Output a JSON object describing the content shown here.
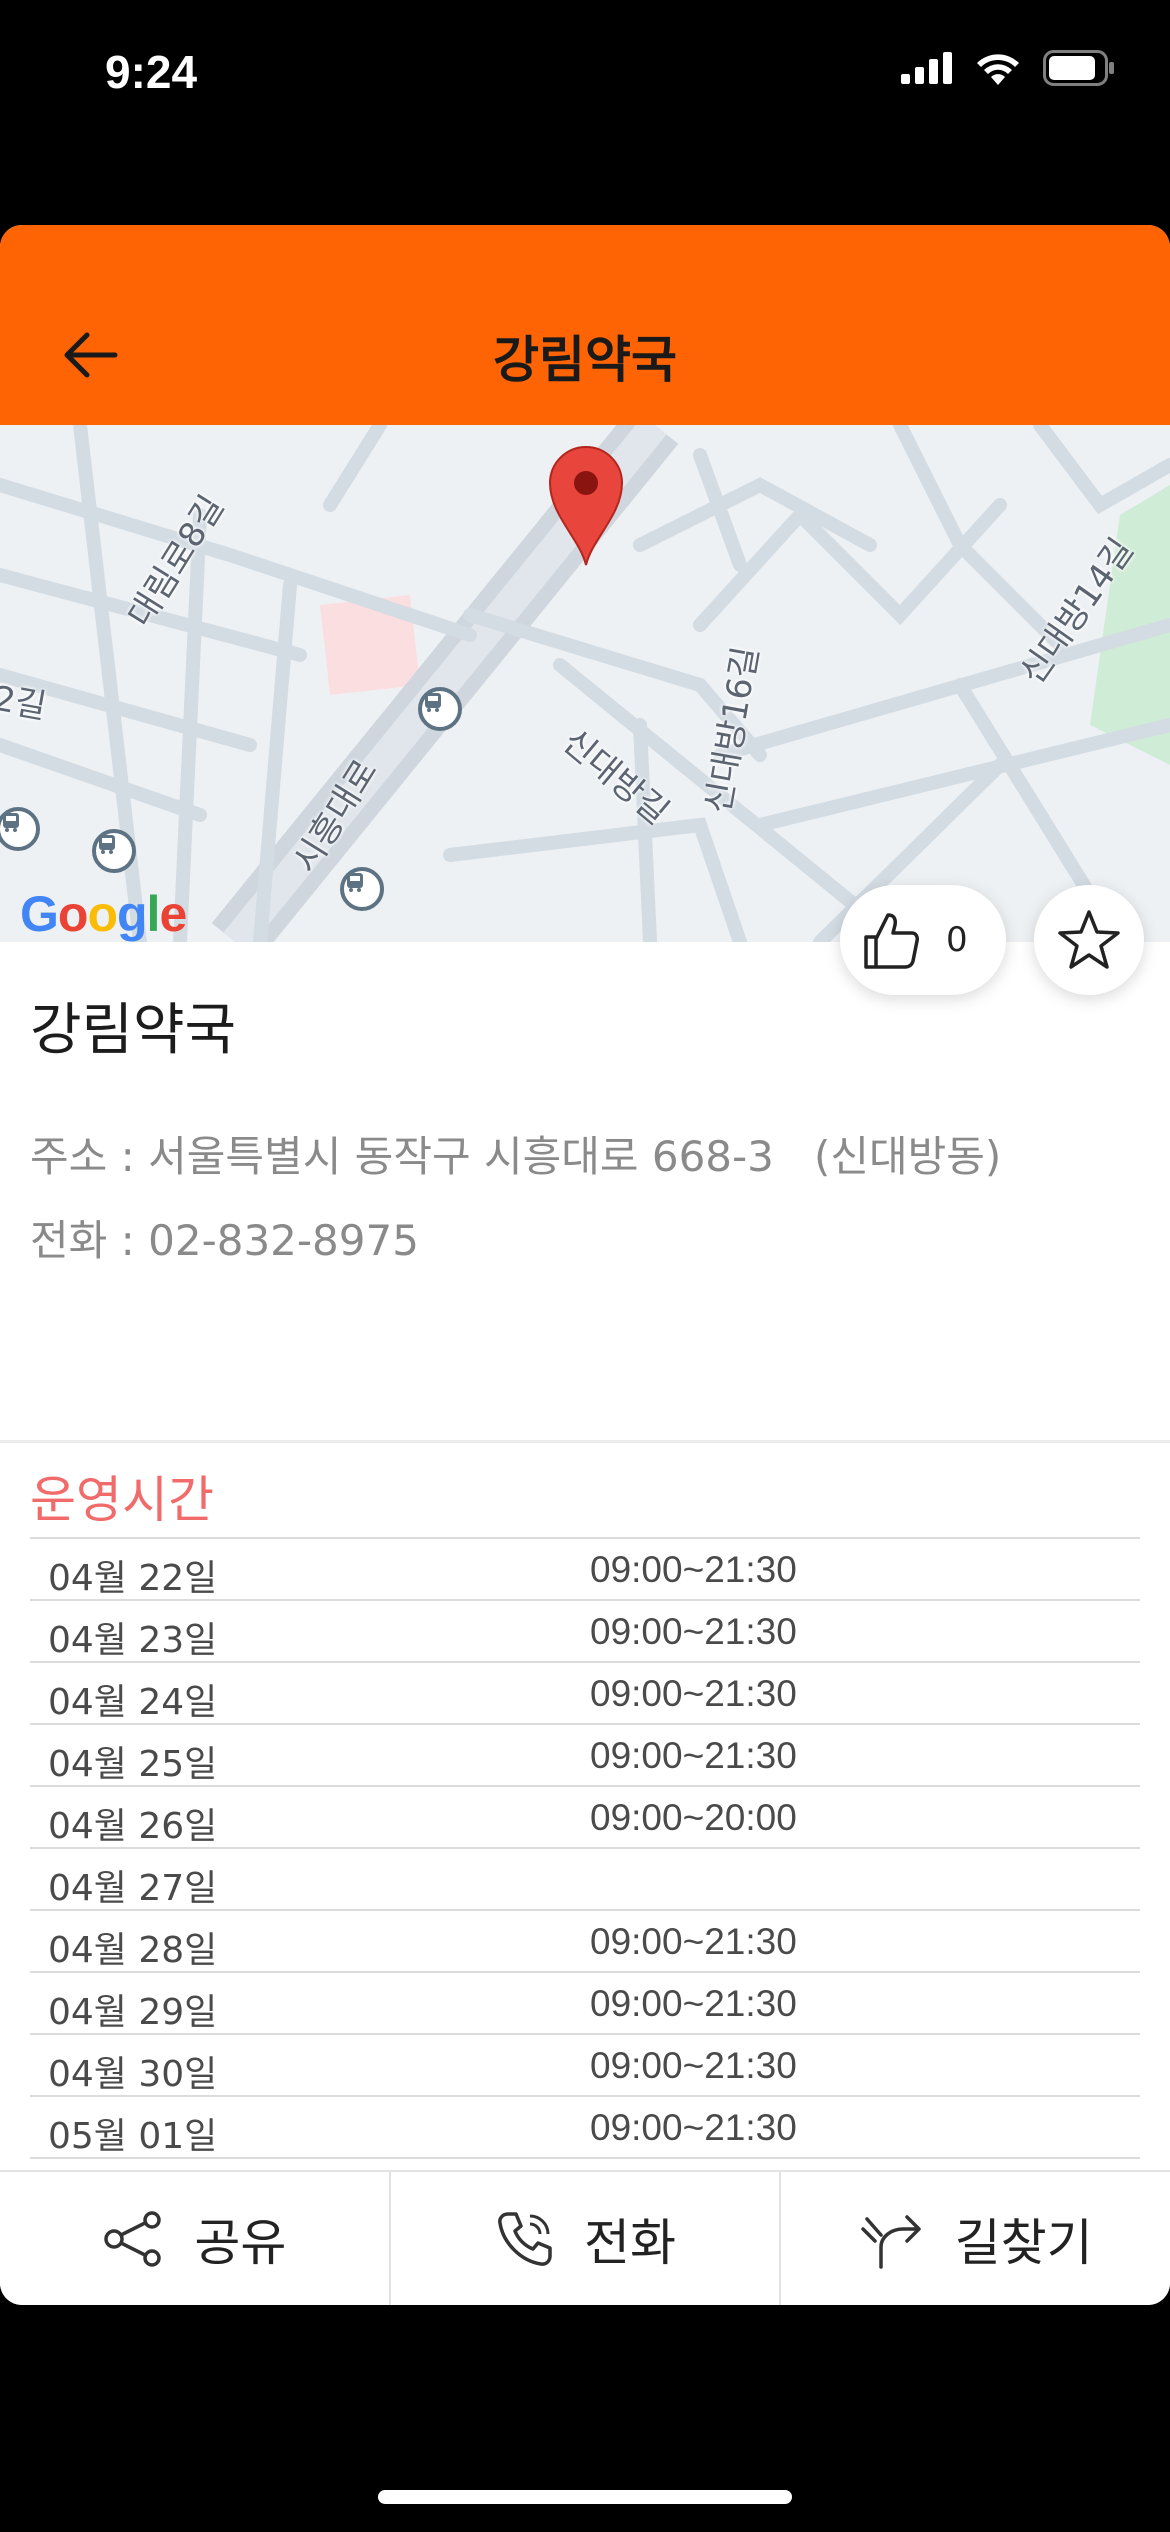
{
  "status": {
    "time": "9:24"
  },
  "header": {
    "title": "강림약국"
  },
  "map": {
    "labels": [
      "대림로8길",
      "2길",
      "시흥대로",
      "신대방길",
      "신대방16길",
      "신대방14길"
    ],
    "logo": "Google"
  },
  "actions": {
    "like_count": "0"
  },
  "place": {
    "name": "강림약국",
    "address_line": "주소 : 서울특별시 동작구 시흥대로 668-3   (신대방동)",
    "phone_line": "전화 : 02-832-8975"
  },
  "hours": {
    "title": "운영시간",
    "rows": [
      {
        "date": "04월 22일",
        "time": "09:00~21:30"
      },
      {
        "date": "04월 23일",
        "time": "09:00~21:30"
      },
      {
        "date": "04월 24일",
        "time": "09:00~21:30"
      },
      {
        "date": "04월 25일",
        "time": "09:00~21:30"
      },
      {
        "date": "04월 26일",
        "time": "09:00~20:00"
      },
      {
        "date": "04월 27일",
        "time": ""
      },
      {
        "date": "04월 28일",
        "time": "09:00~21:30"
      },
      {
        "date": "04월 29일",
        "time": "09:00~21:30"
      },
      {
        "date": "04월 30일",
        "time": "09:00~21:30"
      },
      {
        "date": "05월 01일",
        "time": "09:00~21:30"
      }
    ]
  },
  "bottom_bar": {
    "share": "공유",
    "call": "전화",
    "directions": "길찾기"
  },
  "colors": {
    "header": "#FF6404",
    "hours_title": "#F26B6B",
    "pin": "#E8453C"
  }
}
